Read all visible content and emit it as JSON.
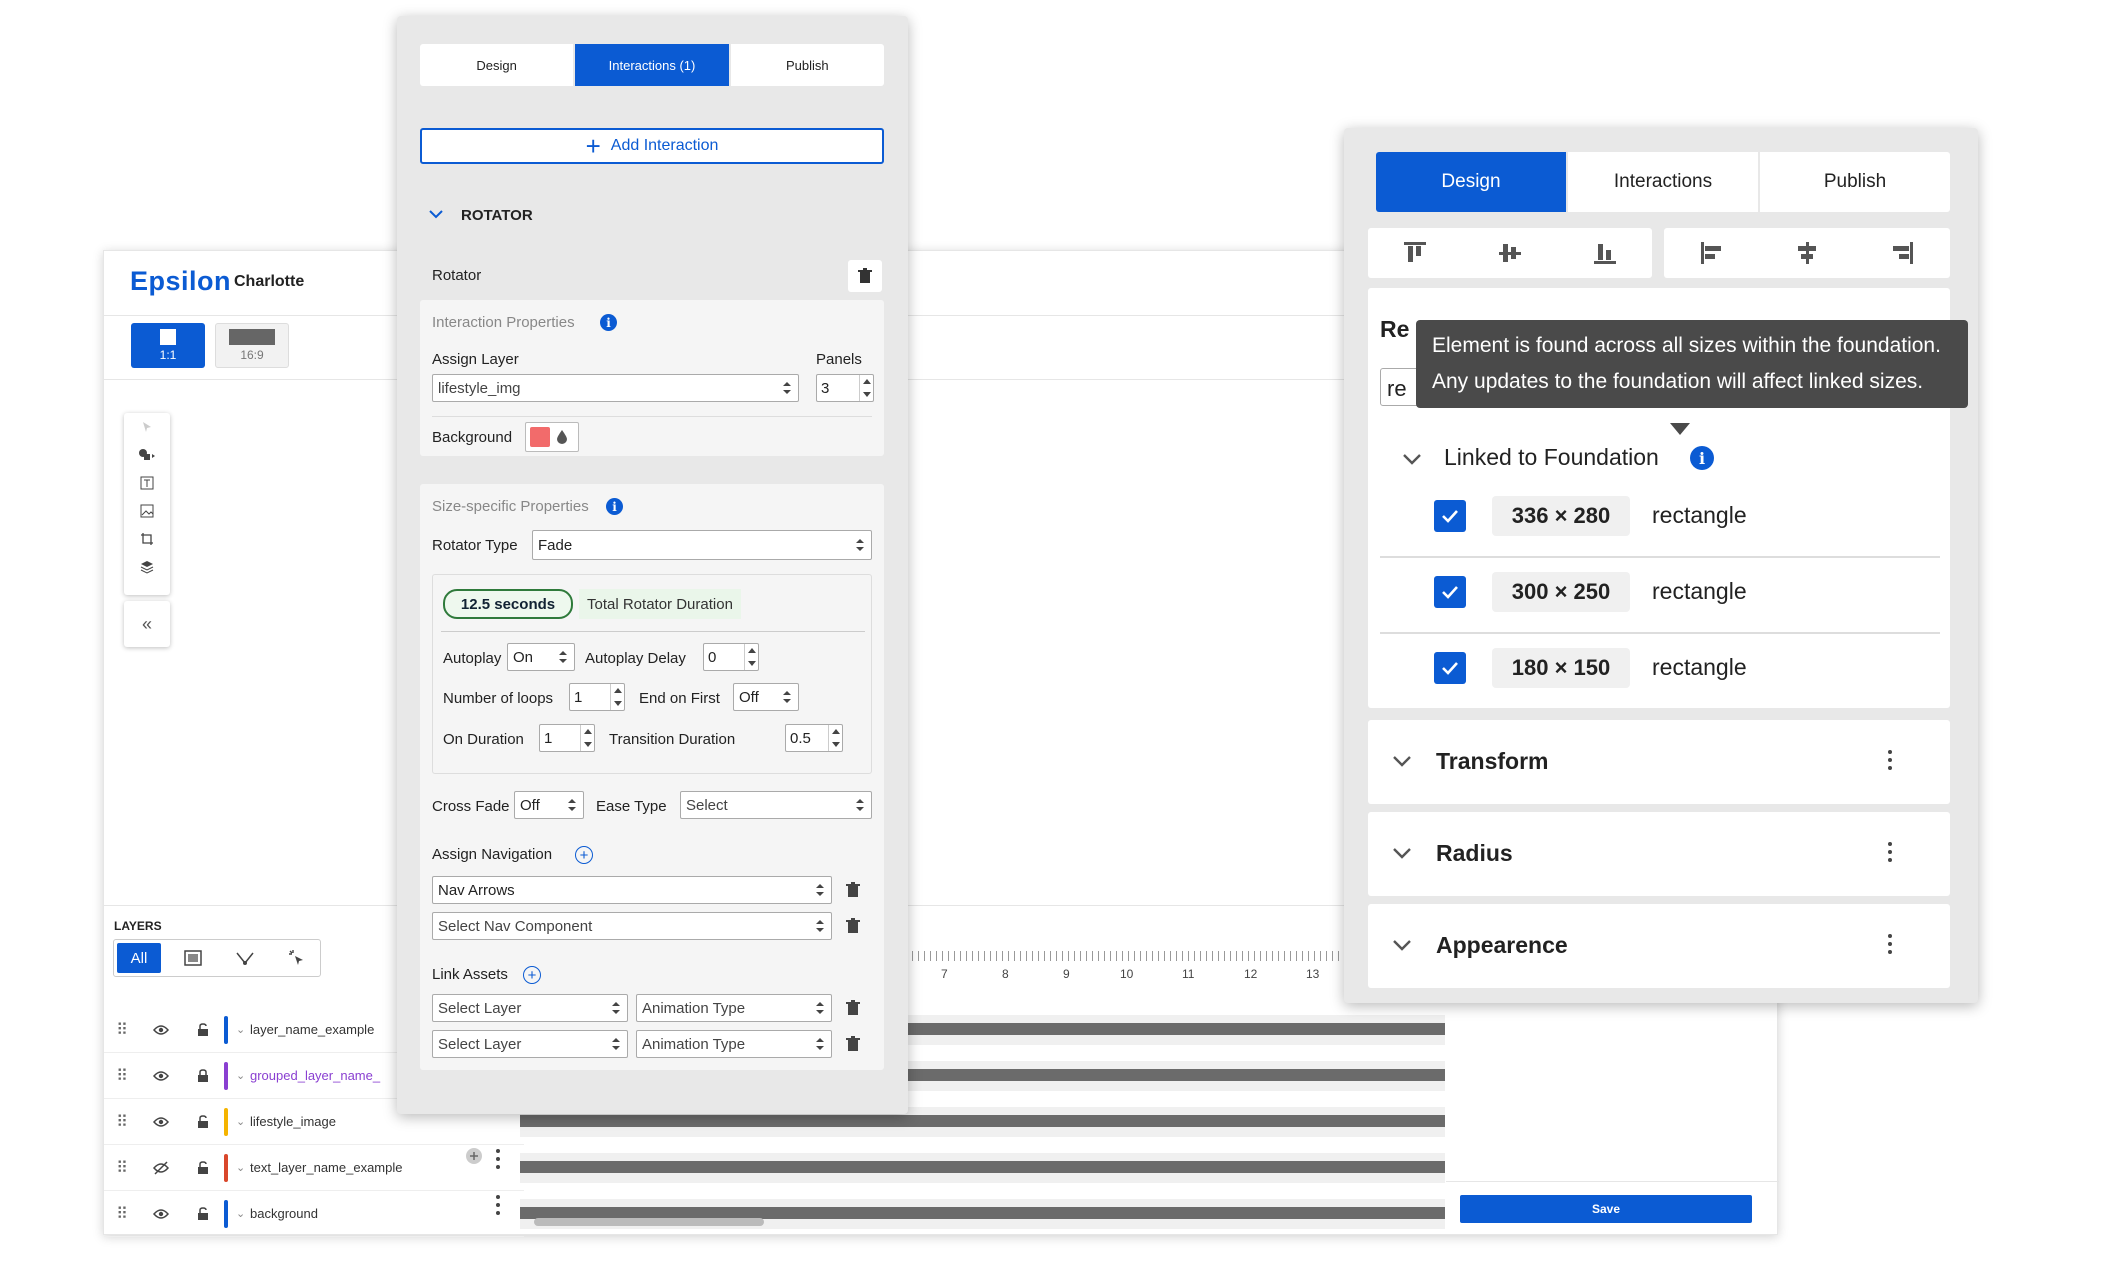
{
  "app": {
    "logo": "Epsilon",
    "project": "Charlotte",
    "ratios": [
      {
        "label": "1:1",
        "active": true
      },
      {
        "label": "16:9",
        "active": false
      }
    ],
    "layers_label": "LAYERS",
    "filter_all": "All",
    "layers": [
      {
        "name": "layer_name_example",
        "color": "#0b5bd3",
        "locked": false,
        "visible": true
      },
      {
        "name": "grouped_layer_name_",
        "color": "#8a3fd1",
        "locked": true,
        "visible": true
      },
      {
        "name": "lifestyle_image",
        "color": "#f5b400",
        "locked": false,
        "visible": true
      },
      {
        "name": "text_layer_name_example",
        "color": "#d9472b",
        "locked": false,
        "visible": false
      },
      {
        "name": "background",
        "color": "#0b5bd3",
        "locked": false,
        "visible": true
      }
    ],
    "ruler_numbers": [
      "7",
      "8",
      "9",
      "10",
      "11",
      "12",
      "13"
    ],
    "save_label": "Save"
  },
  "interactions_panel": {
    "tabs": [
      {
        "label": "Design",
        "active": false
      },
      {
        "label": "Interactions (1)",
        "active": true
      },
      {
        "label": "Publish",
        "active": false
      }
    ],
    "add_interaction": "Add Interaction",
    "section_title": "ROTATOR",
    "rotator_label": "Rotator",
    "interaction_properties": {
      "title": "Interaction Properties",
      "assign_layer_label": "Assign Layer",
      "assign_layer_value": "lifestyle_img",
      "panels_label": "Panels",
      "panels_value": "3",
      "background_label": "Background",
      "background_color": "#f26b6b"
    },
    "size_specific": {
      "title": "Size-specific Properties",
      "rotator_type_label": "Rotator Type",
      "rotator_type_value": "Fade",
      "duration_value": "12.5 seconds",
      "duration_label": "Total Rotator Duration",
      "autoplay_label": "Autoplay",
      "autoplay_value": "On",
      "autoplay_delay_label": "Autoplay Delay",
      "autoplay_delay_value": "0",
      "loops_label": "Number of loops",
      "loops_value": "1",
      "end_on_first_label": "End on First",
      "end_on_first_value": "Off",
      "on_duration_label": "On Duration",
      "on_duration_value": "1",
      "transition_label": "Transition Duration",
      "transition_value": "0.5",
      "cross_fade_label": "Cross Fade",
      "cross_fade_value": "Off",
      "ease_type_label": "Ease Type",
      "ease_type_value": "Select",
      "assign_nav_label": "Assign Navigation",
      "nav_rows": [
        "Nav Arrows",
        "Select Nav Component"
      ],
      "link_assets_label": "Link Assets",
      "asset_rows": [
        {
          "layer": "Select Layer",
          "anim": "Animation Type"
        },
        {
          "layer": "Select Layer",
          "anim": "Animation Type"
        }
      ]
    }
  },
  "design_panel": {
    "tabs": [
      {
        "label": "Design",
        "active": true
      },
      {
        "label": "Interactions",
        "active": false
      },
      {
        "label": "Publish",
        "active": false
      }
    ],
    "card_title_partial": "Re",
    "input_partial": "re",
    "tooltip_line1": "Element is found across all sizes within the foundation.",
    "tooltip_line2": "Any updates to the foundation will affect linked sizes.",
    "linked_label": "Linked to Foundation",
    "sizes": [
      {
        "size": "336 × 280",
        "type": "rectangle",
        "checked": true
      },
      {
        "size": "300 × 250",
        "type": "rectangle",
        "checked": true
      },
      {
        "size": "180 × 150",
        "type": "rectangle",
        "checked": true
      }
    ],
    "sections": [
      "Transform",
      "Radius",
      "Appearence"
    ]
  }
}
